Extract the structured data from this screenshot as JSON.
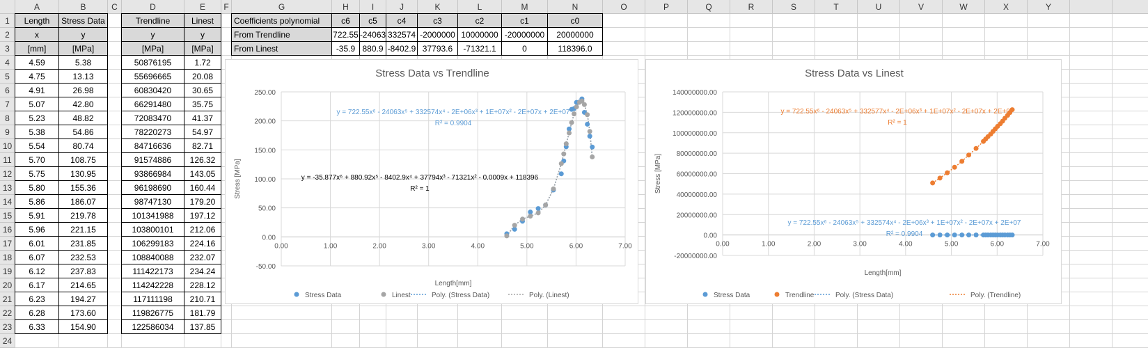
{
  "sheet": {
    "columns": [
      "A",
      "B",
      "C",
      "D",
      "E",
      "F",
      "G",
      "H",
      "I",
      "J",
      "K",
      "L",
      "M",
      "N",
      "O",
      "P",
      "Q",
      "R",
      "S",
      "T",
      "U",
      "V",
      "W",
      "X",
      "Y"
    ],
    "row_count": 24
  },
  "table_data": {
    "headers": [
      [
        "Length",
        "Stress Data"
      ],
      [
        "x",
        "y"
      ],
      [
        "[mm]",
        "[MPa]"
      ]
    ],
    "rows": [
      [
        "4.59",
        "5.38"
      ],
      [
        "4.75",
        "13.13"
      ],
      [
        "4.91",
        "26.98"
      ],
      [
        "5.07",
        "42.80"
      ],
      [
        "5.23",
        "48.82"
      ],
      [
        "5.38",
        "54.86"
      ],
      [
        "5.54",
        "80.74"
      ],
      [
        "5.70",
        "108.75"
      ],
      [
        "5.75",
        "130.95"
      ],
      [
        "5.80",
        "155.36"
      ],
      [
        "5.86",
        "186.07"
      ],
      [
        "5.91",
        "219.78"
      ],
      [
        "5.96",
        "221.15"
      ],
      [
        "6.01",
        "231.85"
      ],
      [
        "6.07",
        "232.53"
      ],
      [
        "6.12",
        "237.83"
      ],
      [
        "6.17",
        "214.65"
      ],
      [
        "6.23",
        "194.27"
      ],
      [
        "6.28",
        "173.60"
      ],
      [
        "6.33",
        "154.90"
      ]
    ]
  },
  "table_fit": {
    "headers": [
      [
        "Trendline",
        "Linest"
      ],
      [
        "y",
        "y"
      ],
      [
        "[MPa]",
        "[MPa]"
      ]
    ],
    "rows": [
      [
        "50876195",
        "1.72"
      ],
      [
        "55696665",
        "20.08"
      ],
      [
        "60830420",
        "30.65"
      ],
      [
        "66291480",
        "35.75"
      ],
      [
        "72083470",
        "41.37"
      ],
      [
        "78220273",
        "54.97"
      ],
      [
        "84716636",
        "82.71"
      ],
      [
        "91574886",
        "126.32"
      ],
      [
        "93866984",
        "143.05"
      ],
      [
        "96198690",
        "160.44"
      ],
      [
        "98747130",
        "179.20"
      ],
      [
        "101341988",
        "197.12"
      ],
      [
        "103800101",
        "212.06"
      ],
      [
        "106299183",
        "224.16"
      ],
      [
        "108840088",
        "232.07"
      ],
      [
        "111422173",
        "234.24"
      ],
      [
        "114242228",
        "228.12"
      ],
      [
        "117111198",
        "210.71"
      ],
      [
        "119826775",
        "181.79"
      ],
      [
        "122586034",
        "137.85"
      ]
    ]
  },
  "coefficients": {
    "title": "Coefficients polynomial",
    "labels": [
      "c6",
      "c5",
      "c4",
      "c3",
      "c2",
      "c1",
      "c0"
    ],
    "rows": [
      {
        "label": "From Trendline",
        "values": [
          "722.55",
          "-24063",
          "332574",
          "-2000000",
          "10000000",
          "-20000000",
          "20000000"
        ]
      },
      {
        "label": "From Linest",
        "values": [
          "-35.9",
          "880.9",
          "-8402.9",
          "37793.6",
          "-71321.1",
          "0",
          "118396.0"
        ]
      }
    ]
  },
  "chart_data": [
    {
      "type": "scatter",
      "title": "Stress Data vs Trendline",
      "xlabel": "Length[mm]",
      "ylabel": "Stress [MPa]",
      "xlim": [
        0,
        7
      ],
      "ylim": [
        -50,
        250
      ],
      "xticks": [
        "0.00",
        "1.00",
        "2.00",
        "3.00",
        "4.00",
        "5.00",
        "6.00",
        "7.00"
      ],
      "yticks": [
        "-50.00",
        "0.00",
        "50.00",
        "100.00",
        "150.00",
        "200.00",
        "250.00"
      ],
      "x": [
        4.59,
        4.75,
        4.91,
        5.07,
        5.23,
        5.38,
        5.54,
        5.7,
        5.75,
        5.8,
        5.86,
        5.91,
        5.96,
        6.01,
        6.07,
        6.12,
        6.17,
        6.23,
        6.28,
        6.33
      ],
      "series": [
        {
          "name": "Stress Data",
          "color": "#5b9bd5",
          "values": [
            5.38,
            13.13,
            26.98,
            42.8,
            48.82,
            54.86,
            80.74,
            108.75,
            130.95,
            155.36,
            186.07,
            219.78,
            221.15,
            231.85,
            232.53,
            237.83,
            214.65,
            194.27,
            173.6,
            154.9
          ]
        },
        {
          "name": "Linest",
          "color": "#a5a5a5",
          "values": [
            1.72,
            20.08,
            30.65,
            35.75,
            41.37,
            54.97,
            82.71,
            126.32,
            143.05,
            160.44,
            179.2,
            197.12,
            212.06,
            224.16,
            232.07,
            234.24,
            228.12,
            210.71,
            181.79,
            137.85
          ]
        }
      ],
      "trendlines": [
        {
          "name": "Poly. (Stress Data)",
          "color": "#5b9bd5",
          "equation": "y = 722.55x⁶ - 24063x⁵ + 332574x⁴ - 2E+06x³ + 1E+07x² - 2E+07x + 2E+07",
          "r2": "R² = 0.9904"
        },
        {
          "name": "Poly. (Linest)",
          "color": "#a5a5a5",
          "label_color": "#000000",
          "equation": "y = -35.877x⁶ + 880.92x⁵ - 8402.9x⁴ + 37794x³ - 71321x² - 0.0009x + 118396",
          "r2": "R² = 1"
        }
      ],
      "legend": "bottom"
    },
    {
      "type": "scatter",
      "title": "Stress Data vs Linest",
      "xlabel": "Length[mm]",
      "ylabel": "Stress [MPa]",
      "xlim": [
        0,
        7
      ],
      "ylim": [
        -20000000,
        140000000
      ],
      "xticks": [
        "0.00",
        "1.00",
        "2.00",
        "3.00",
        "4.00",
        "5.00",
        "6.00",
        "7.00"
      ],
      "yticks": [
        "-20000000.00",
        "0.00",
        "20000000.00",
        "40000000.00",
        "60000000.00",
        "80000000.00",
        "100000000.00",
        "120000000.00",
        "140000000.00"
      ],
      "x": [
        4.59,
        4.75,
        4.91,
        5.07,
        5.23,
        5.38,
        5.54,
        5.7,
        5.75,
        5.8,
        5.86,
        5.91,
        5.96,
        6.01,
        6.07,
        6.12,
        6.17,
        6.23,
        6.28,
        6.33
      ],
      "series": [
        {
          "name": "Stress Data",
          "color": "#5b9bd5",
          "values": [
            5.38,
            13.13,
            26.98,
            42.8,
            48.82,
            54.86,
            80.74,
            108.75,
            130.95,
            155.36,
            186.07,
            219.78,
            221.15,
            231.85,
            232.53,
            237.83,
            214.65,
            194.27,
            173.6,
            154.9
          ]
        },
        {
          "name": "Trendline",
          "color": "#ed7d31",
          "values": [
            50876195,
            55696665,
            60830420,
            66291480,
            72083470,
            78220273,
            84716636,
            91574886,
            93866984,
            96198690,
            98747130,
            101341988,
            103800101,
            106299183,
            108840088,
            111422173,
            114242228,
            117111198,
            119826775,
            122586034
          ]
        }
      ],
      "trendlines": [
        {
          "name": "Poly. (Stress Data)",
          "color": "#5b9bd5",
          "equation": "y = 722.55x⁶ - 24063x⁵ + 332574x⁴ - 2E+06x³ + 1E+07x² - 2E+07x + 2E+07",
          "r2": "R² = 0.9904"
        },
        {
          "name": "Poly. (Trendline)",
          "color": "#ed7d31",
          "equation": "y = 722.55x⁶ - 24063x⁵ + 332577x⁴ - 2E+06x³ + 1E+07x² - 2E+07x + 2E+07",
          "r2": "R² = 1"
        }
      ],
      "legend": "bottom"
    }
  ]
}
